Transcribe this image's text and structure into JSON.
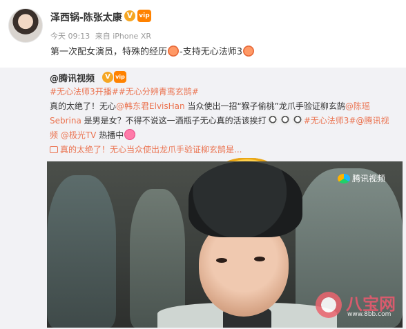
{
  "post": {
    "author": "泽西锅-陈张太康",
    "meta": {
      "time": "今天 09:13",
      "source": "来自 iPhone XR"
    },
    "text_part1": "第一次配女演员，特殊的经历",
    "text_part2": "-支持无心法师3"
  },
  "repost": {
    "author": "@腾讯视频",
    "hashtags": "#无心法师3开播##无心分辨青鸾玄鹄#",
    "body": {
      "line1_a": "真的太绝了",
      "line1_b": "！无心",
      "line1_mention": "@韩东君ElvisHan",
      "line1_c": " 当众使出一招“猴子偷桃”龙爪手验证柳玄鹄",
      "line1_mention2": "@陈瑶",
      "line2_mention": "Sebrina",
      "line2_a": " 是男是女",
      "line2_b": "？不得不说这一酒瓶子无心真的活该挨打",
      "line2_tag": "#无心法师3#",
      "line2_mention3": "@腾讯视",
      "line3_mention": "频",
      "line3_mention2": " @极光TV",
      "line3_a": " 热播中"
    },
    "video_link": "真的太绝了！无心当众使出龙爪手验证柳玄鹄是..."
  },
  "video": {
    "logo_text": "腾讯视频"
  },
  "watermark": {
    "brand": "八宝网",
    "url": "www.8bb.com"
  },
  "colors": {
    "link": "#eb7350",
    "repost_bg": "#f2f2f5",
    "verified": "#f5a623"
  }
}
